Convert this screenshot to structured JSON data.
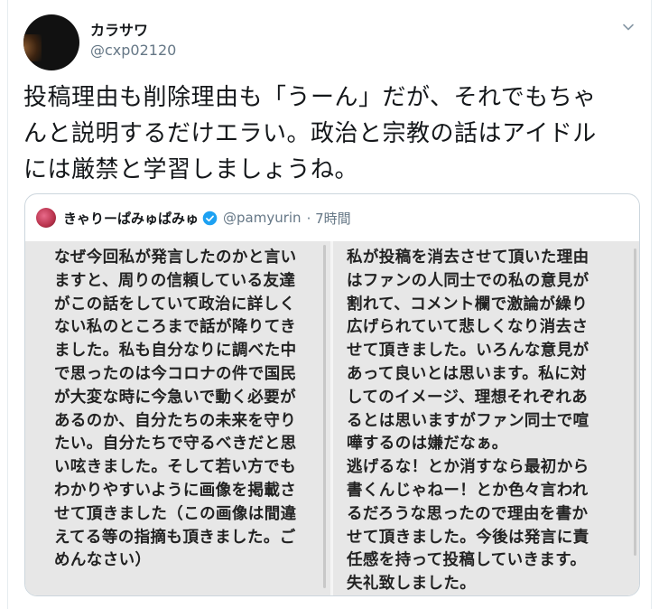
{
  "tweet": {
    "author_name": "カラサワ",
    "author_handle": "@cxp02120",
    "lines": [
      "投稿理由も削除理由も「うーん」だが、それでもちゃ",
      "んと説明するだけエラい。政治と宗教の話はアイドル",
      "には厳禁と学習しましょうね。"
    ]
  },
  "quoted": {
    "author_name": "きゃりーぱみゅぱみゅ",
    "author_handle": "@pamyurin",
    "time": "· 7時間",
    "image_text": {
      "left_lines": [
        "なぜ今回私が発言したのかと言い",
        "ますと、周りの信頼している友達",
        "がこの話をしていて政治に詳しく",
        "ない私のところまで話が降りてき",
        "ました。私も自分なりに調べた中",
        "で思ったのは今コロナの件で国民",
        "が大変な時に今急いで動く必要が",
        "あるのか、自分たちの未来を守り",
        "たい。自分たちで守るべきだと思",
        "い呟きました。そして若い方でも",
        "わかりやすいように画像を掲載さ",
        "せて頂きました（この画像は間違",
        "えてる等の指摘も頂きました。ご",
        "めんなさい）"
      ],
      "right_lines": [
        "私が投稿を消去させて頂いた理由",
        "はファンの人同士での私の意見が",
        "割れて、コメント欄で激論が繰り",
        "広げられていて悲しくなり消去さ",
        "せて頂きました。いろんな意見が",
        "あって良いとは思います。私に対",
        "してのイメージ、理想それぞれあ",
        "るとは思いますがファン同士で喧",
        "嘩するのは嫌だなぁ。",
        "逃げるな！とか消すなら最初から",
        "書くんじゃねー！とか色々言われ",
        "るだろうな思ったので理由を書か",
        "せて頂きました。今後は発言に責",
        "任感を持って投稿していきます。",
        "失礼致しました。"
      ]
    }
  },
  "colors": {
    "text": "#14171a",
    "secondary": "#657786",
    "border": "#ccd6dd",
    "verified": "#1da1f2"
  }
}
